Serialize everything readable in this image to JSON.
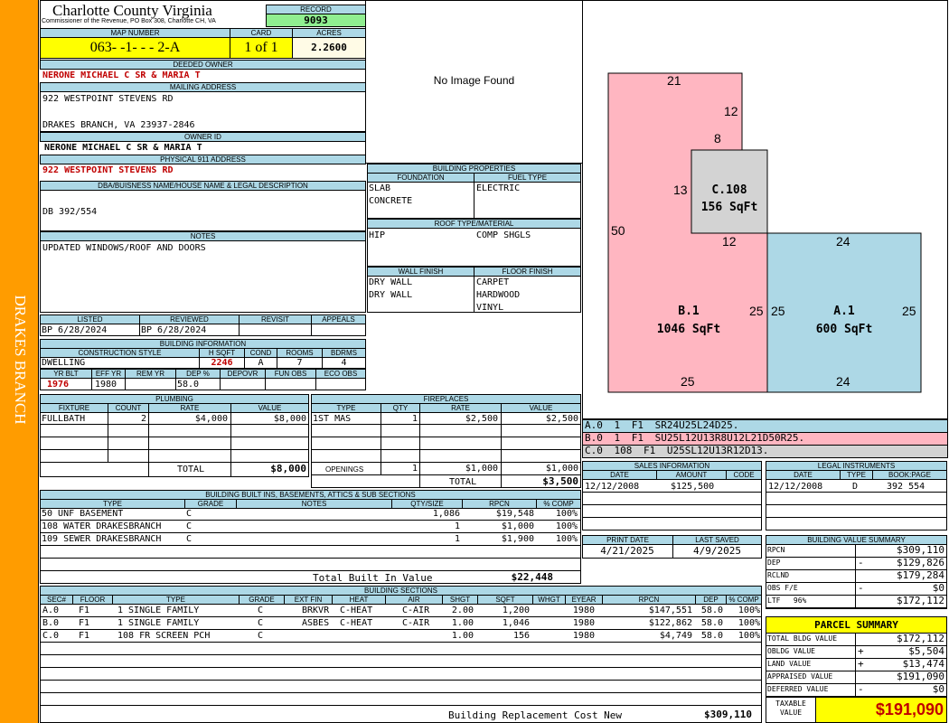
{
  "side": {
    "district": "DRAKES BRANCH"
  },
  "header": {
    "county": "Charlotte County Virginia",
    "office": "Commissioner of the Revenue, PO Box 308, Charlotte CH, VA",
    "record_label": "RECORD",
    "record": "9093",
    "map_label": "MAP NUMBER",
    "map": "063- -1- - - 2-A",
    "card_label": "CARD",
    "card": "1 of 1",
    "acres_label": "ACRES",
    "acres": "2.2600"
  },
  "owner": {
    "deeded_label": "DEEDED OWNER",
    "deeded": "NERONE MICHAEL C SR & MARIA T",
    "mailing_label": "MAILING ADDRESS",
    "addr1": "922 WESTPOINT STEVENS RD",
    "addr2": "DRAKES BRANCH, VA 23937-2846",
    "id_label": "OWNER ID",
    "owner_id": "NERONE MICHAEL C SR & MARIA T",
    "phys_label": "PHYSICAL 911 ADDRESS",
    "physical": "922 WESTPOINT STEVENS RD",
    "dba_label": "DBA/BUISNESS NAME/HOUSE NAME & LEGAL DESCRIPTION",
    "dba": "DB 392/554",
    "notes_label": "NOTES",
    "notes": "UPDATED WINDOWS/ROOF AND DOORS"
  },
  "image": {
    "placeholder": "No Image Found"
  },
  "props": {
    "title": "BUILDING PROPERTIES",
    "foundation_label": "FOUNDATION",
    "foundation": [
      "SLAB",
      "CONCRETE"
    ],
    "fuel_label": "FUEL TYPE",
    "fuel": [
      "ELECTRIC"
    ],
    "roof_label": "ROOF TYPE/MATERIAL",
    "roof": "HIP",
    "roof_mat": "COMP SHGLS",
    "wall_label": "WALL FINISH",
    "wall": [
      "DRY WALL",
      "DRY WALL"
    ],
    "floor_label": "FLOOR FINISH",
    "floor": [
      "CARPET",
      "HARDWOOD",
      "VINYL"
    ]
  },
  "dates": {
    "listed_label": "LISTED",
    "listed": "BP 6/28/2024",
    "reviewed_label": "REVIEWED",
    "reviewed": "BP 6/28/2024",
    "revisit_label": "REVISIT",
    "appeals_label": "APPEALS"
  },
  "binfo": {
    "title": "BUILDING INFORMATION",
    "style_label": "CONSTRUCTION STYLE",
    "style": "DWELLING",
    "hsqft_label": "H SQFT",
    "hsqft": "2246",
    "cond_label": "COND",
    "cond": "A",
    "rooms_label": "ROOMS",
    "rooms": "7",
    "bdrms_label": "BDRMS",
    "bdrms": "4",
    "yrblt_label": "YR BLT",
    "yrblt": "1976",
    "effyr_label": "EFF YR",
    "effyr": "1980",
    "remyr_label": "REM YR",
    "dep_label": "DEP %",
    "dep": "58.0",
    "depovr_label": "DEPOVR",
    "funobs_label": "FUN OBS",
    "ecoobs_label": "ECO OBS"
  },
  "plumbing": {
    "title": "PLUMBING",
    "h": [
      "FIXTURE",
      "COUNT",
      "RATE",
      "VALUE"
    ],
    "row": [
      "FULLBATH",
      "2",
      "$4,000",
      "$8,000"
    ],
    "total_label": "TOTAL",
    "total": "$8,000"
  },
  "fireplaces": {
    "title": "FIREPLACES",
    "h": [
      "TYPE",
      "QTY",
      "RATE",
      "VALUE"
    ],
    "row": [
      "1ST MAS",
      "1",
      "$2,500",
      "$2,500"
    ],
    "openings_label": "OPENINGS",
    "openings": [
      "1",
      "$1,000",
      "$1,000"
    ],
    "total_label": "TOTAL",
    "total": "$3,500"
  },
  "builtins": {
    "title": "BUILDING BUILT INS, BASEMENTS, ATTICS & SUB SECTIONS",
    "h": [
      "TYPE",
      "GRADE",
      "NOTES",
      "QTY/SIZE",
      "RPCN",
      "% COMP"
    ],
    "rows": [
      [
        "50 UNF BASEMENT",
        "C",
        "",
        "1,086",
        "$19,548",
        "100%"
      ],
      [
        "108 WATER DRAKESBRANCH",
        "C",
        "",
        "1",
        "$1,000",
        "100%"
      ],
      [
        "109 SEWER DRAKESBRANCH",
        "C",
        "",
        "1",
        "$1,900",
        "100%"
      ]
    ],
    "total_label": "Total Built In Value",
    "total": "$22,448"
  },
  "sections": {
    "title": "BUILDING SECTIONS",
    "h": [
      "SEC#",
      "FLOOR",
      "TYPE",
      "GRADE",
      "EXT FIN",
      "HEAT",
      "AIR",
      "SHGT",
      "SQFT",
      "WHGT",
      "EYEAR",
      "RPCN",
      "DEP",
      "% COMP"
    ],
    "rows": [
      [
        "A.0",
        "F1",
        "1 SINGLE FAMILY",
        "C",
        "BRKVR",
        "C-HEAT",
        "C-AIR",
        "2.00",
        "1,200",
        "",
        "1980",
        "$147,551",
        "58.0",
        "100%"
      ],
      [
        "B.0",
        "F1",
        "1 SINGLE FAMILY",
        "C",
        "ASBES",
        "C-HEAT",
        "C-AIR",
        "1.00",
        "1,046",
        "",
        "1980",
        "$122,862",
        "58.0",
        "100%"
      ],
      [
        "C.0",
        "F1",
        "108 FR SCREEN PCH",
        "C",
        "",
        "",
        "",
        "1.00",
        "156",
        "",
        "1980",
        "$4,749",
        "58.0",
        "100%"
      ]
    ],
    "total_label": "Building Replacement Cost New",
    "total": "$309,110"
  },
  "sketch": {
    "a_label": "A.1",
    "a_sqft": "600 SqFt",
    "b_label": "B.1",
    "b_sqft": "1046 SqFt",
    "c_label": "C.108",
    "c_sqft": "156 SqFt",
    "dims": [
      "21",
      "12",
      "8",
      "13",
      "50",
      "12",
      "24",
      "25",
      "25",
      "25",
      "25",
      "24"
    ],
    "color_a": "#add8e6",
    "color_b": "#ffb6c1",
    "color_c": "#d3d3d3"
  },
  "vectors": [
    {
      "text": "A.0 1 F1 SR24U25L24D25."
    },
    {
      "text": "B.0 1 F1 SU25L12U13R8U12L21D50R25."
    },
    {
      "text": "C.0 108 F1 U25SL12U13R12D13."
    }
  ],
  "sales": {
    "title": "SALES INFORMATION",
    "h": [
      "DATE",
      "AMOUNT",
      "CODE"
    ],
    "row": [
      "12/12/2008",
      "$125,500",
      ""
    ]
  },
  "legal": {
    "title": "LEGAL INSTRUMENTS",
    "h": [
      "DATE",
      "TYPE",
      "BOOK:PAGE"
    ],
    "row": [
      "12/12/2008",
      "D",
      "392 554"
    ]
  },
  "print": {
    "print_label": "PRINT DATE",
    "print_date": "4/21/2025",
    "saved_label": "LAST SAVED",
    "saved": "4/9/2025"
  },
  "bvs": {
    "title": "BUILDING VALUE SUMMARY",
    "rows": [
      [
        "RPCN",
        "",
        "$309,110"
      ],
      [
        "DEP",
        "-",
        "$129,826"
      ],
      [
        "RCLND",
        "",
        "$179,284"
      ],
      [
        "OBS F/E",
        "-",
        "$0"
      ],
      [
        "LTF   96%",
        "",
        "$172,112"
      ]
    ]
  },
  "parcel": {
    "title": "PARCEL SUMMARY",
    "rows": [
      [
        "TOTAL BLDG VALUE",
        "",
        "$172,112"
      ],
      [
        "OBLDG VALUE",
        "+",
        "$5,504"
      ],
      [
        "LAND VALUE",
        "+",
        "$13,474"
      ],
      [
        "APPRAISED VALUE",
        "",
        "$191,090"
      ],
      [
        "DEFERRED VALUE",
        "-",
        "$0"
      ]
    ],
    "taxable_label": "TAXABLE VALUE",
    "taxable": "$191,090"
  }
}
